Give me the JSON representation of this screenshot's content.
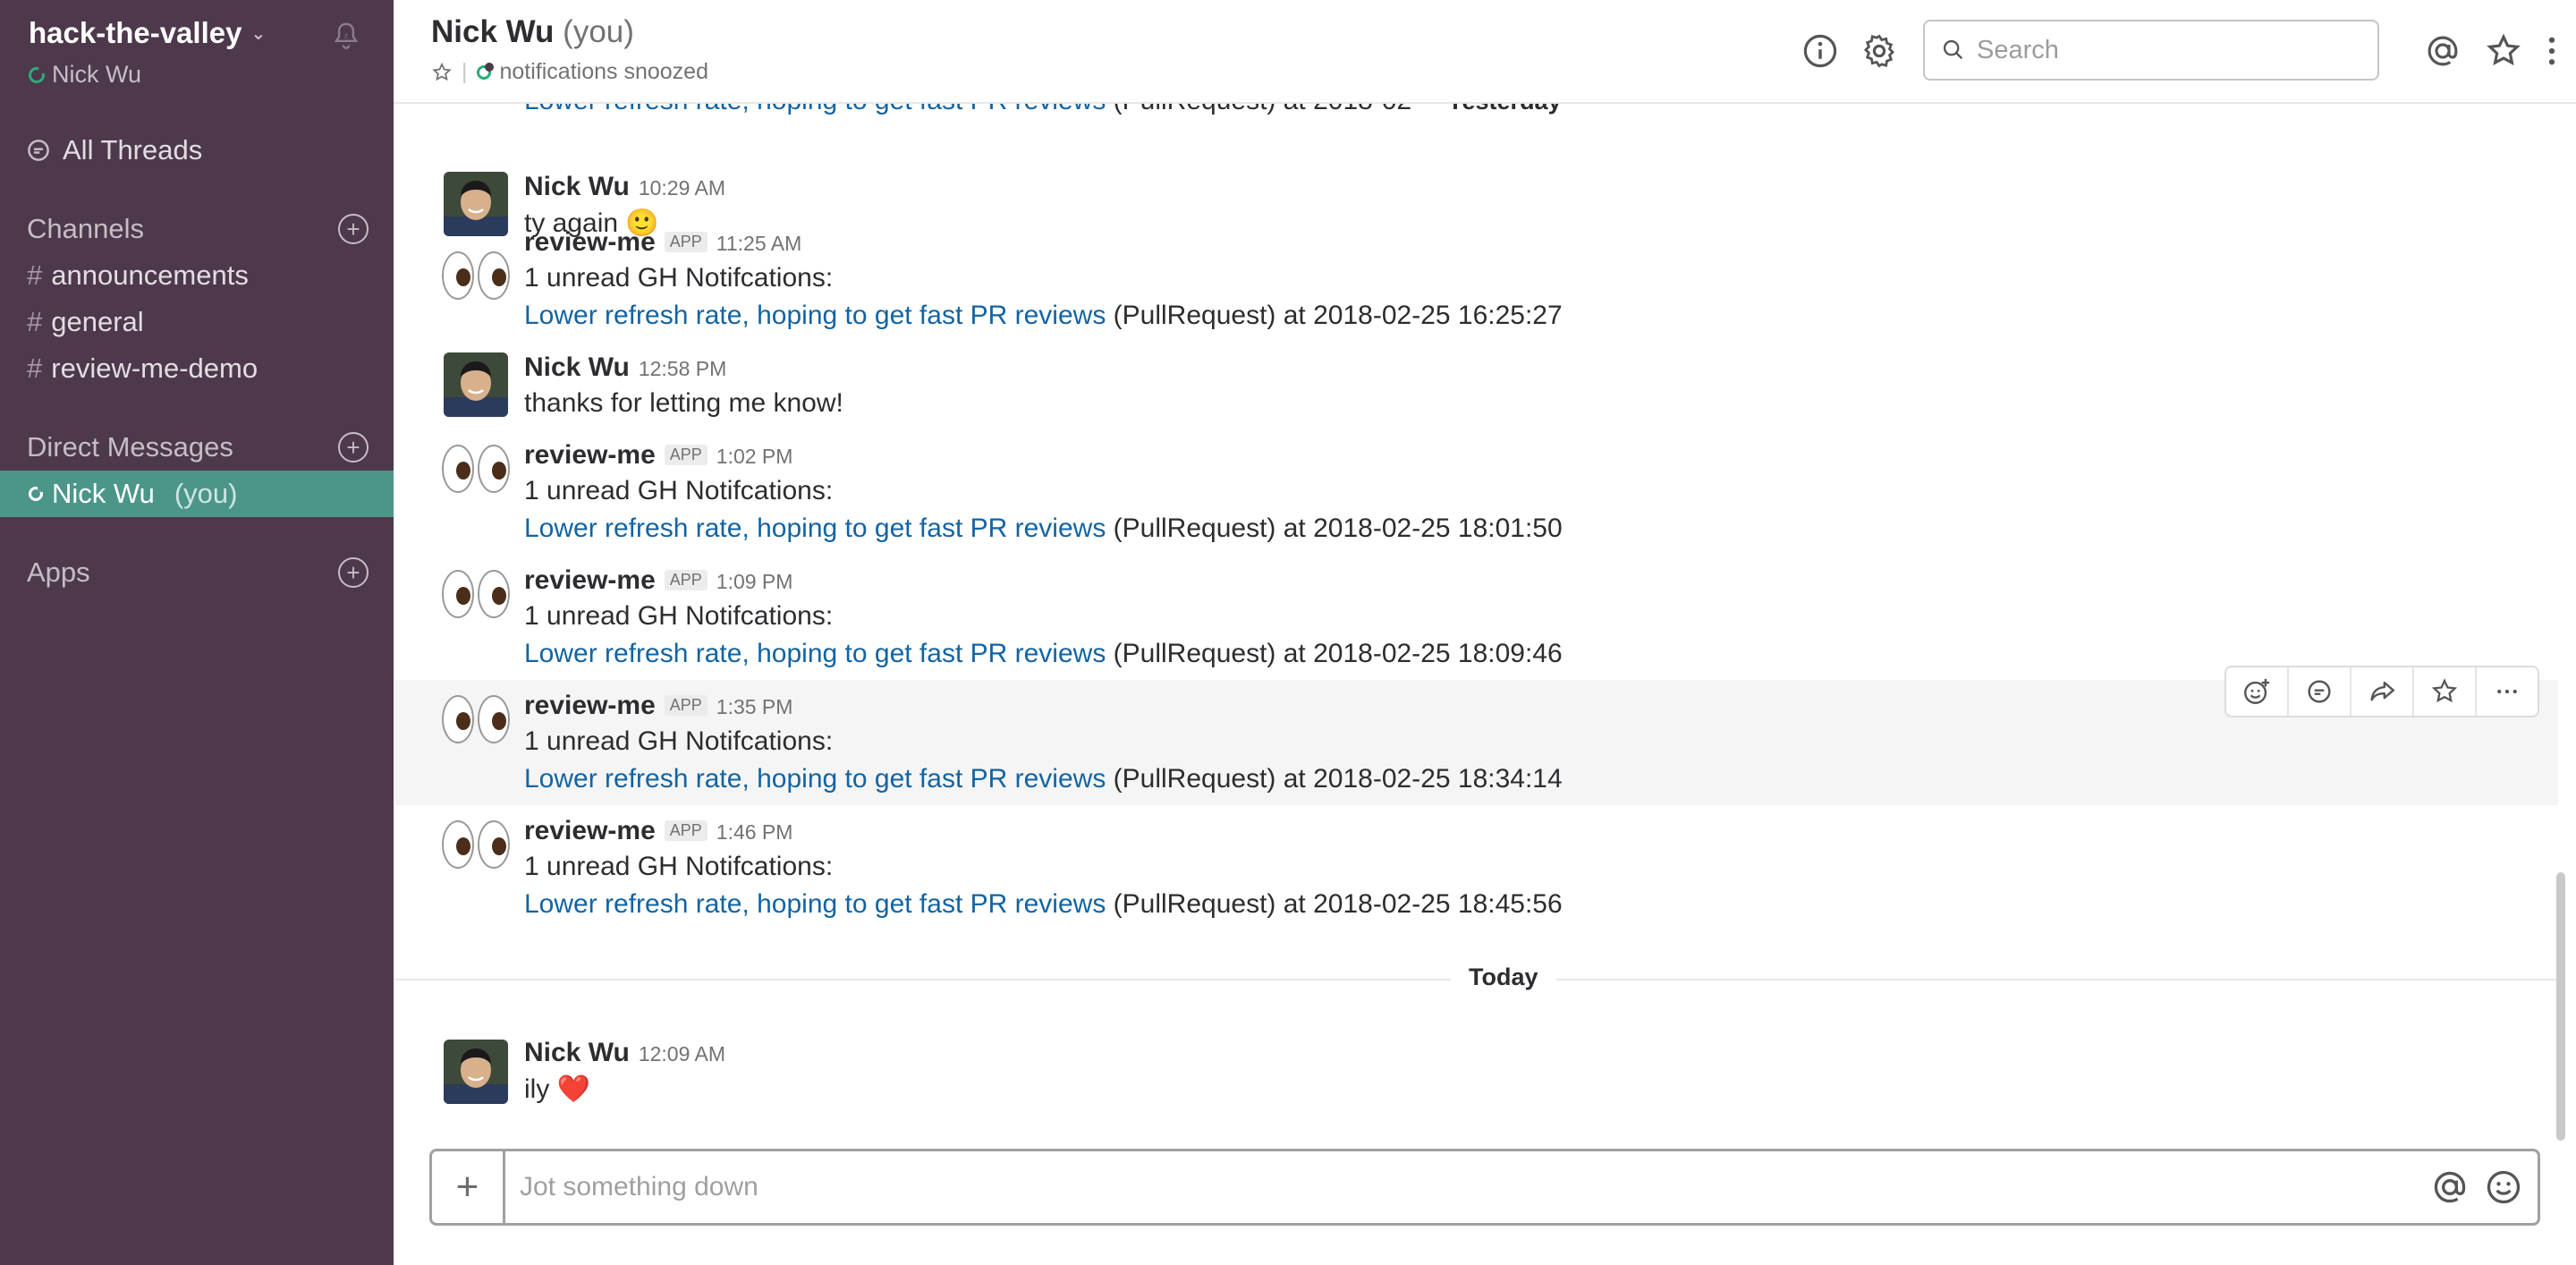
{
  "workspace": {
    "name": "hack-the-valley",
    "user": "Nick Wu"
  },
  "sidebar": {
    "all_threads": "All Threads",
    "channels_label": "Channels",
    "channels": [
      "announcements",
      "general",
      "review-me-demo"
    ],
    "dm_label": "Direct Messages",
    "dm_active": {
      "name": "Nick Wu",
      "suffix": "(you)"
    },
    "apps_label": "Apps"
  },
  "header": {
    "title": "Nick Wu",
    "title_suffix": "(you)",
    "status": "notifications snoozed",
    "search_placeholder": "Search"
  },
  "messages": {
    "top_cut_line": {
      "link": "Lower refresh rate, hoping to get fast PR reviews",
      "rest": "(PullRequest) at 2018-02-",
      "divider": "Yesterday"
    },
    "items": [
      {
        "author": "Nick Wu",
        "time": "10:29 AM",
        "text": "ty again",
        "emoji": "🙂"
      },
      {
        "author": "review-me",
        "badge": "APP",
        "time": "11:25 AM",
        "text": "1 unread GH Notifcations:",
        "link": "Lower refresh rate, hoping to get fast PR reviews",
        "rest": "(PullRequest) at 2018-02-25 16:25:27"
      },
      {
        "author": "Nick Wu",
        "time": "12:58 PM",
        "text": "thanks for letting me know!"
      },
      {
        "author": "review-me",
        "badge": "APP",
        "time": "1:02 PM",
        "text": "1 unread GH Notifcations:",
        "link": "Lower refresh rate, hoping to get fast PR reviews",
        "rest": "(PullRequest) at 2018-02-25 18:01:50"
      },
      {
        "author": "review-me",
        "badge": "APP",
        "time": "1:09 PM",
        "text": "1 unread GH Notifcations:",
        "link": "Lower refresh rate, hoping to get fast PR reviews",
        "rest": "(PullRequest) at 2018-02-25 18:09:46"
      },
      {
        "author": "review-me",
        "badge": "APP",
        "time": "1:35 PM",
        "text": "1 unread GH Notifcations:",
        "link": "Lower refresh rate, hoping to get fast PR reviews",
        "rest": "(PullRequest) at 2018-02-25 18:34:14"
      },
      {
        "author": "review-me",
        "badge": "APP",
        "time": "1:46 PM",
        "text": "1 unread GH Notifcations:",
        "link": "Lower refresh rate, hoping to get fast PR reviews",
        "rest": "(PullRequest) at 2018-02-25 18:45:56"
      },
      {
        "author": "Nick Wu",
        "time": "12:09 AM",
        "text": "ily",
        "emoji": "❤️"
      }
    ],
    "today_divider": "Today"
  },
  "composer": {
    "placeholder": "Jot something down"
  },
  "colors": {
    "sidebar_bg": "#4d394b",
    "active_item": "#4c9689",
    "link": "#1264a3",
    "presence": "#2bac76"
  }
}
